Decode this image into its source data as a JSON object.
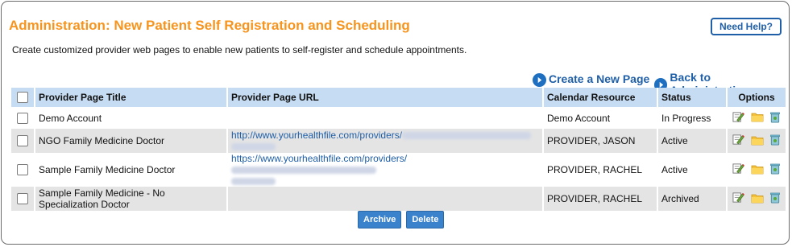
{
  "header": {
    "title": "Administration: New Patient Self Registration and Scheduling",
    "help_label": "Need Help?",
    "description": "Create customized provider web pages to enable new patients to self-register and schedule appointments."
  },
  "actions": {
    "create_label": "Create a New Page",
    "back_label": "Back to Administration"
  },
  "table": {
    "columns": [
      "Provider Page Title",
      "Provider Page URL",
      "Calendar Resource",
      "Status",
      "Options"
    ],
    "rows": [
      {
        "title": "Demo Account",
        "url": "",
        "resource": "Demo Account",
        "status": "In Progress"
      },
      {
        "title": "NGO Family Medicine Doctor",
        "url": "http://www.yourhealthfile.com/providers/",
        "resource": "PROVIDER, JASON",
        "status": "Active"
      },
      {
        "title": "Sample Family Medicine Doctor",
        "url": "https://www.yourhealthfile.com/providers/",
        "resource": "PROVIDER, RACHEL",
        "status": "Active"
      },
      {
        "title": "Sample Family Medicine - No Specialization Doctor",
        "url": "",
        "resource": "PROVIDER, RACHEL",
        "status": "Archived"
      }
    ]
  },
  "buttons": {
    "archive_label": "Archive",
    "delete_label": "Delete"
  },
  "icons": {
    "option_icons": [
      "edit-icon",
      "folder-icon",
      "trash-icon"
    ],
    "action_icon": "circle-arrow-right-icon"
  },
  "colors": {
    "title": "#f7941d",
    "link": "#1f5fa8",
    "header_bg": "#c6dcf3",
    "row_alt_bg": "#e4e4e4",
    "button_bg": "#3b82cc"
  }
}
